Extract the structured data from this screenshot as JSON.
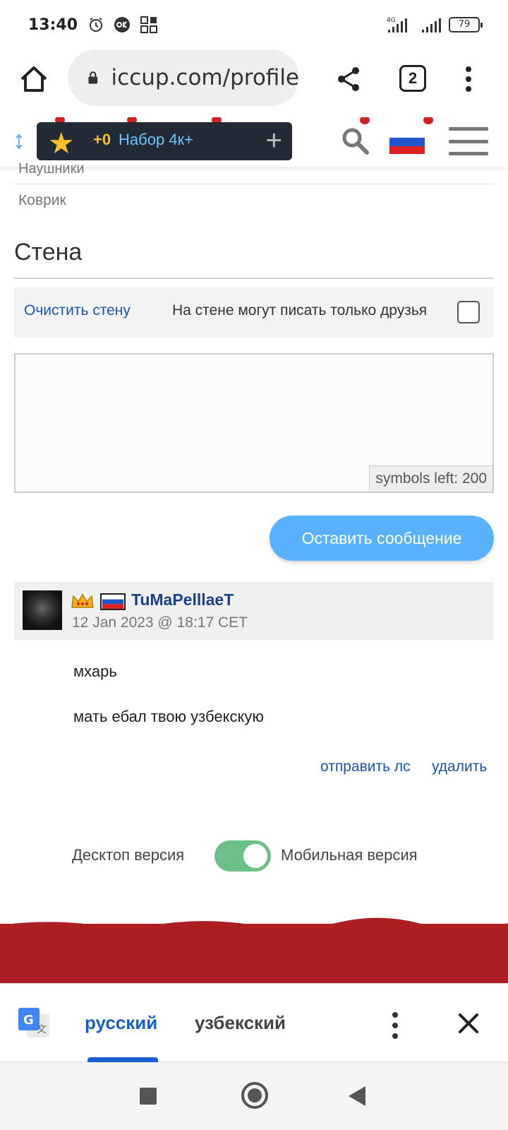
{
  "status_bar": {
    "time": "13:40",
    "battery": "79",
    "network": "4G"
  },
  "browser": {
    "url": "iccup.com/profile",
    "tab_count": "2"
  },
  "header": {
    "promo_prefix": "+0",
    "promo_label": "Набор 4к+"
  },
  "equipment": {
    "clipped_item": "Наушники",
    "item": "Коврик"
  },
  "wall": {
    "title": "Стена",
    "clear_label": "Очистить стену",
    "friends_only_label": "На стене могут писать только друзья",
    "symbols_left": "symbols left: 200",
    "post_button": "Оставить сообщение"
  },
  "post": {
    "username": "TuMaPelllaeT",
    "date": "12 Jan 2023 @ 18:17 CET",
    "lines": [
      "мхарь",
      "мать ебал твою узбекскую"
    ],
    "send_pm": "отправить лс",
    "delete": "удалить"
  },
  "version": {
    "desktop": "Десктоп версия",
    "mobile": "Мобильная версия",
    "mobile_selected": true
  },
  "translate": {
    "source": "русский",
    "target": "узбекский"
  },
  "colors": {
    "accent_blue": "#58b1fa",
    "link_blue": "#1c57a6",
    "footer_red": "#ad1e22",
    "toggle_green": "#6dbf8a"
  }
}
